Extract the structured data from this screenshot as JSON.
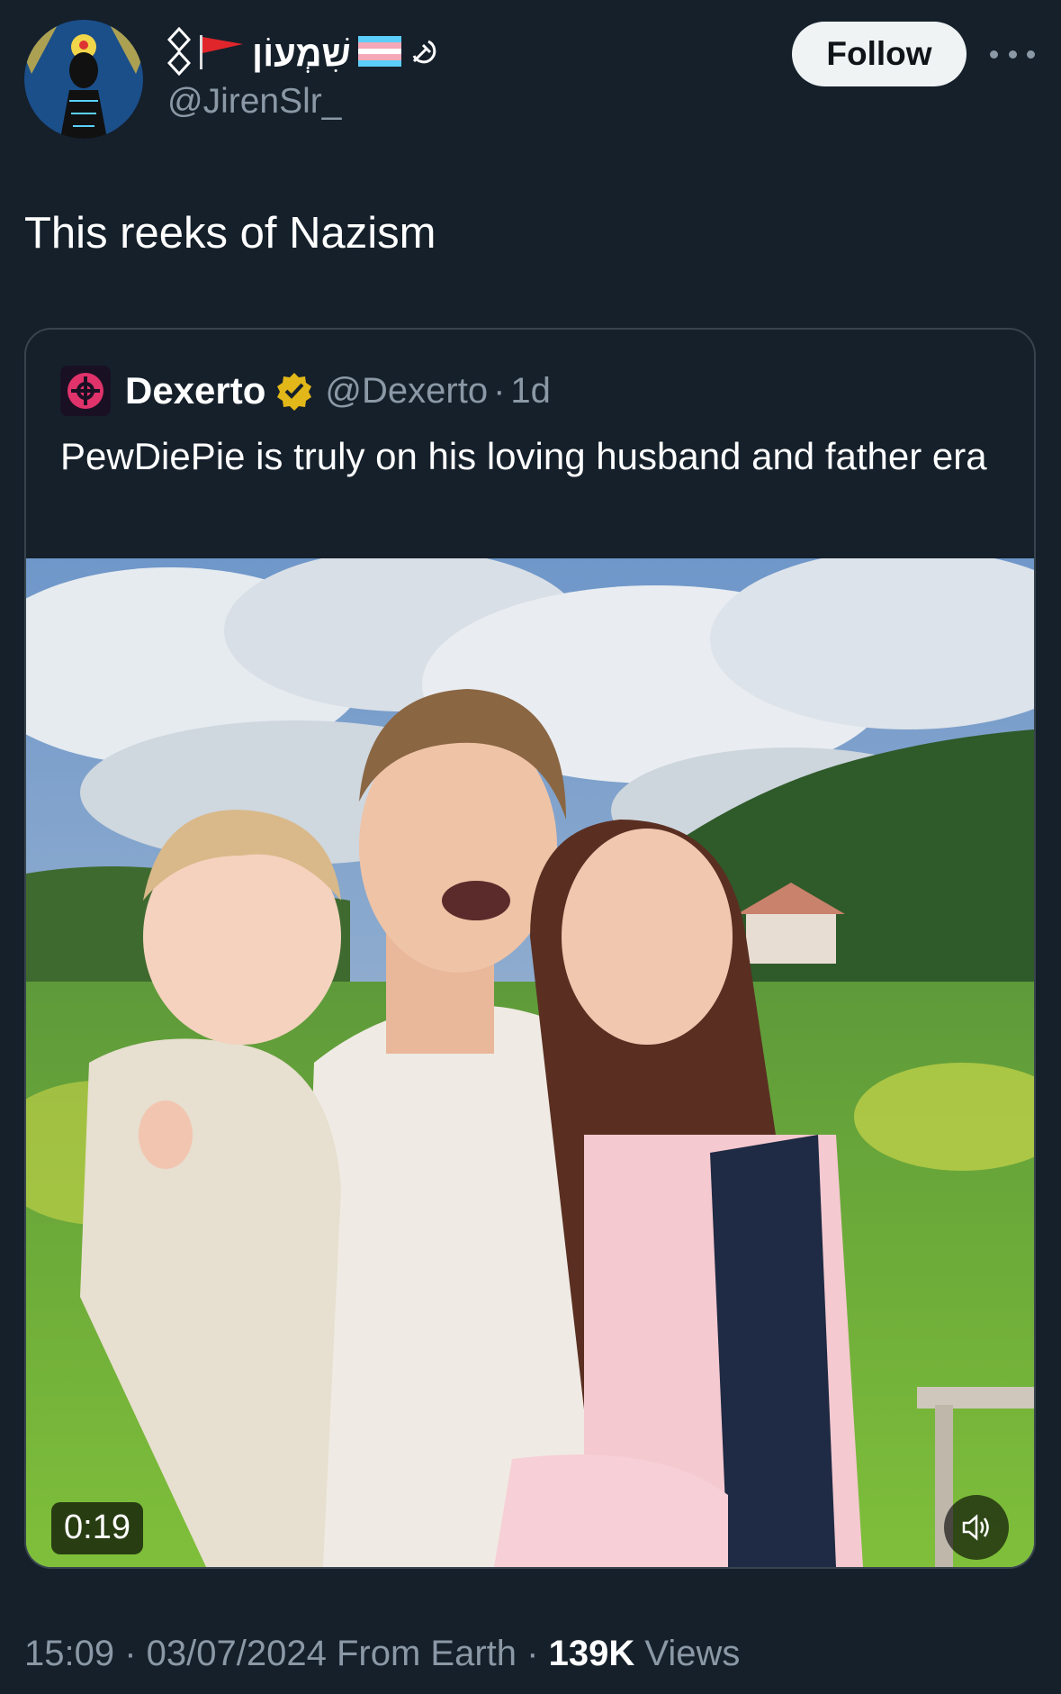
{
  "author": {
    "display_name": "שִׁמְעוֹן",
    "handle": "@JirenSlr_",
    "emoji_flags": [
      "red-flag-icon",
      "trans-flag-icon",
      "hammer-sickle-icon"
    ]
  },
  "follow_label": "Follow",
  "tweet": {
    "text": "This reeks of Nazism",
    "time": "15:09",
    "date": "03/07/2024",
    "source": "From Earth",
    "views_count": "139K",
    "views_label": "Views"
  },
  "quote": {
    "name": "Dexerto",
    "handle": "@Dexerto",
    "age": "1d",
    "text": "PewDiePie is truly on his loving husband and father era",
    "video_duration": "0:19"
  },
  "colors": {
    "background": "#15202b",
    "secondary_text": "#8b98a5",
    "verified_gold": "#e2b719",
    "border": "#38444d"
  }
}
